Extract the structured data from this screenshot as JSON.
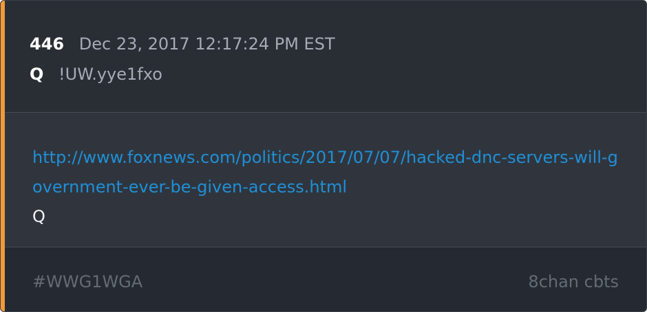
{
  "post": {
    "number": "446",
    "date": "Dec 23, 2017 12:17:24 PM EST",
    "author": "Q",
    "tripcode": "!UW.yye1fxo",
    "link": "http://www.foxnews.com/politics/2017/07/07/hacked-dnc-servers-will-government-ever-be-given-access.html",
    "signature": "Q"
  },
  "footer": {
    "hashtag": "#WWG1WGA",
    "source": "8chan cbts"
  },
  "colors": {
    "accent": "#f29a38",
    "link": "#1f8fd6",
    "background": "#2a2e35"
  }
}
